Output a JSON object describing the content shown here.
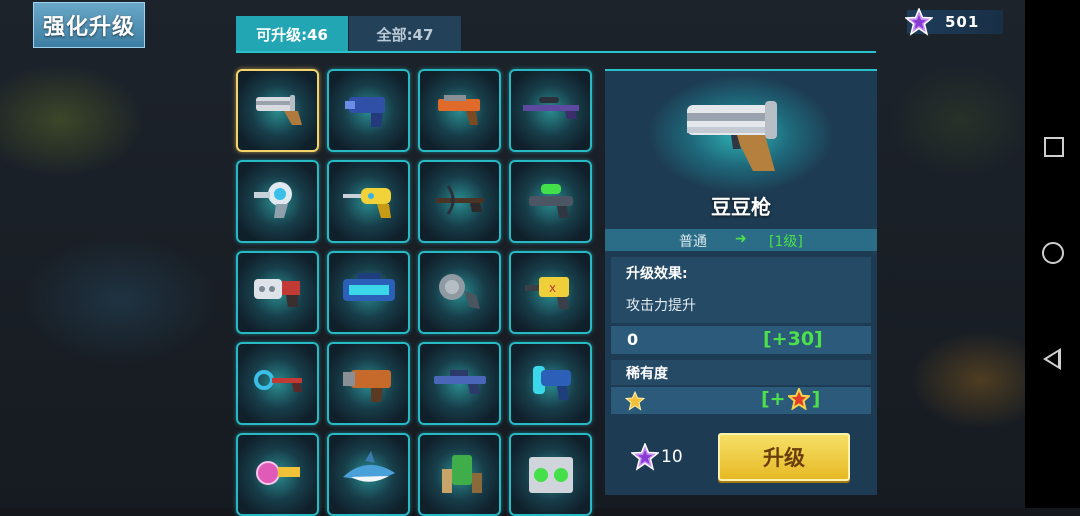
{
  "header": {
    "title": "强化升级",
    "tabs": [
      {
        "label": "可升级:46",
        "active": true
      },
      {
        "label": "全部:47",
        "active": false
      }
    ]
  },
  "currency": {
    "icon": "purple-star-icon",
    "value": "501"
  },
  "close": {
    "label": "✕"
  },
  "weapons": [
    {
      "icon": "pea-gun-icon",
      "selected": true
    },
    {
      "icon": "blue-blaster-icon"
    },
    {
      "icon": "orange-pistol-icon"
    },
    {
      "icon": "sniper-rifle-icon"
    },
    {
      "icon": "ray-gun-icon"
    },
    {
      "icon": "yellow-water-gun-icon"
    },
    {
      "icon": "crossbow-icon"
    },
    {
      "icon": "green-plasma-gun-icon"
    },
    {
      "icon": "gatling-shotgun-icon"
    },
    {
      "icon": "blue-energy-cannon-icon"
    },
    {
      "icon": "grey-orb-gun-icon"
    },
    {
      "icon": "yellow-blaster-icon"
    },
    {
      "icon": "ring-blade-gun-icon"
    },
    {
      "icon": "rocket-launcher-icon"
    },
    {
      "icon": "assault-rifle-icon"
    },
    {
      "icon": "cyan-pulse-gun-icon"
    },
    {
      "icon": "pink-orb-gun-icon"
    },
    {
      "icon": "shark-launcher-icon"
    },
    {
      "icon": "green-cannon-icon"
    },
    {
      "icon": "speaker-box-icon"
    }
  ],
  "detail": {
    "name": "豆豆枪",
    "rarity": "普通",
    "arrow": "➜",
    "level": "[1级]",
    "effect_title": "升级效果:",
    "effect_desc": "攻击力提升",
    "stat_current": "0",
    "stat_add": "[+30]",
    "rarity_title": "稀有度",
    "rarity_add_prefix": "[+",
    "rarity_add_suffix": "]",
    "cost": "10",
    "upgrade_label": "升级"
  },
  "colors": {
    "accent": "#28c1cc",
    "tab_active": "#22a6b3",
    "bonus_green": "#4ce04c",
    "button_yellow": "#f0cc3c",
    "close_red": "#c93b35"
  }
}
